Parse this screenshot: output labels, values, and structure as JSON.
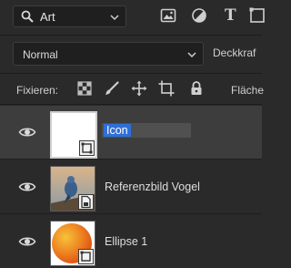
{
  "filter": {
    "kind_value": "Art"
  },
  "blend": {
    "mode": "Normal",
    "opacity_label": "Deckkraf"
  },
  "lock": {
    "label": "Fixieren:",
    "fill_label": "Fläche"
  },
  "layers": [
    {
      "name": "Icon",
      "selected": true,
      "editing": true
    },
    {
      "name": "Referenzbild Vogel",
      "selected": false
    },
    {
      "name": "Ellipse 1",
      "selected": false
    }
  ],
  "colors": {
    "panel_bg": "#2a2a2a",
    "selected_row": "#3d3d3d",
    "text_selection": "#2f6fd8"
  }
}
